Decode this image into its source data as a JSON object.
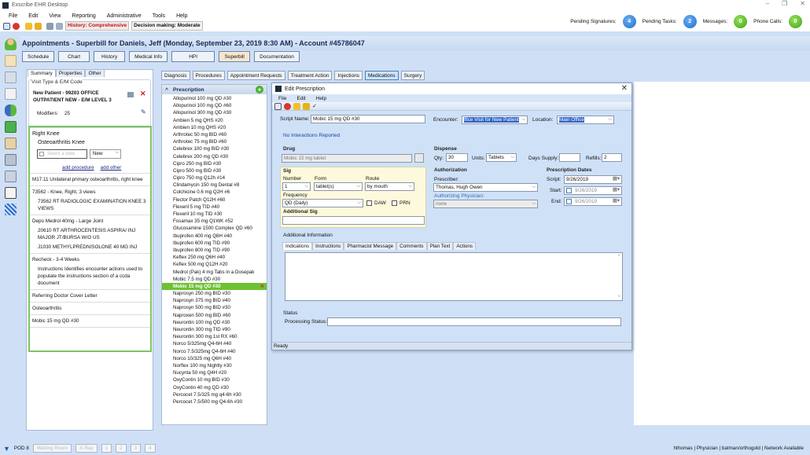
{
  "window": {
    "title": "Exscribe EHR Desktop",
    "controls": [
      "–",
      "❐",
      "✕"
    ]
  },
  "menu": [
    "File",
    "Edit",
    "View",
    "Reporting",
    "Administrative",
    "Tools",
    "Help"
  ],
  "toolbar": {
    "history_badge": "History: Comprehensive",
    "decision_badge": "Decision making: Moderate"
  },
  "notifications": [
    {
      "label": "Pending Signatures:",
      "count": "4",
      "color": "blue"
    },
    {
      "label": "Pending Tasks:",
      "count": "2",
      "color": "blue"
    },
    {
      "label": "Messages:",
      "count": "0",
      "color": "green"
    },
    {
      "label": "Phone Calls:",
      "count": "0",
      "color": "green"
    }
  ],
  "sidebar_icons": [
    "person-icon",
    "calendar-icon",
    "mail-icon",
    "document-icon",
    "users-icon",
    "checklist-icon",
    "notebook-icon",
    "phone-icon",
    "printer-icon",
    "pen-icon",
    "grid-icon"
  ],
  "header": {
    "title": "Appointments - Superbill for Daniels, Jeff (Monday, September 23, 2019 8:30 AM) - Account #45786047"
  },
  "nav_buttons": [
    {
      "label": "Schedule",
      "active": false
    },
    {
      "label": "Chart",
      "active": false
    },
    {
      "label": "History",
      "active": false
    },
    {
      "label": "Medical Info",
      "active": false
    },
    {
      "label": "HPI",
      "active": false
    },
    {
      "label": "Superbill",
      "active": true
    },
    {
      "label": "Documentation",
      "active": false
    }
  ],
  "left_panel": {
    "tabs": [
      "Summary",
      "Properties",
      "Other"
    ],
    "visit_label": "Visit Type & E/M Code",
    "visit_code": "New Patient - 99203 OFFICE OUTPATIENT NEW - E/M LEVEL 3",
    "modifiers_label": "Modifiers:",
    "modifiers_value": "25",
    "section_title": "Right Knee",
    "diagnosis_title": "Osteoarthritis Knee",
    "date_placeholder": "Select a date",
    "status_select": "New",
    "add_procedure": "add procedure",
    "add_other": "add other",
    "items": [
      {
        "text": "M17.11 Unilateral primary osteoarthritis, right knee",
        "sub": []
      },
      {
        "text": "73562 - Knee, Right, 3 views",
        "sub": [
          "73562  RT RADIOLOGIC EXAMINATION KNEE 3 VIEWS"
        ]
      },
      {
        "text": "Depo Medrol 40mg - Large Joint",
        "sub": [
          "20610  RT ARTHROCENTESIS ASPIRA/ INJ MAJOR JT/BURSA W/O US",
          "J1030  METHYLPREDNISOLONE 40 MG INJ"
        ]
      },
      {
        "text": "Recheck - 3-4 Weeks",
        "sub": [
          "Instructions Identifies encounter actions used to populate the instructions section of a ccda document"
        ]
      },
      {
        "text": "Referring Doctor Cover Letter",
        "sub": []
      },
      {
        "text": "Osteoarthritis",
        "sub": []
      },
      {
        "text": "Mobic 15 mg QD #30",
        "sub": []
      }
    ]
  },
  "right_tabs": [
    {
      "label": "Diagnosis",
      "active": false
    },
    {
      "label": "Procedures",
      "active": false
    },
    {
      "label": "Appointment Requests",
      "active": false
    },
    {
      "label": "Treatment Action",
      "active": false
    },
    {
      "label": "Injections",
      "active": false
    },
    {
      "label": "Medications",
      "active": true
    },
    {
      "label": "Surgery",
      "active": false
    }
  ],
  "prescriptions": {
    "title": "Prescription",
    "selected_index": 23,
    "items": [
      "Allopurinol 100 mg QD #30",
      "Allopurinol 100 mg QD #60",
      "Allopurinol 300 mg QD #30",
      "Ambien 5 mg QHS #20",
      "Ambien 10 mg QHS #20",
      "Arthrotec 50 mg BID #60",
      "Arthrotec 75 mg BID #60",
      "Celebrex 100 mg BID #30",
      "Celebrex 200 mg QD #30",
      "Cipro 250 mg BID #30",
      "Cipro 500 mg BID #30",
      "Cipro 750 mg Q12h #14",
      "Clindamycin 150 mg Dental #8",
      "Colchicine 0.6 mg Q2H #6",
      "Flector Patch Q12H #60",
      "Flexeril 5 mg TID #40",
      "Flexeril 10 mg TID #30",
      "Fosamax 35 mg Q1WK #52",
      "Glucosamine 1500 Complex QD #60",
      "Ibuprofen 400 mg Q8H #40",
      "Ibuprofen 600 mg TID #90",
      "Ibuprofen 800 mg TID #90",
      "Keflex 250 mg Q6H #40",
      "Keflex 500 mg Q12H #20",
      "Medrol (Pak) 4 mg Tabs in a Dosepak",
      "Mobic 7.5 mg QD #30",
      "Mobic 15 mg QD #30",
      "Naprosyn 250 mg BID #30",
      "Naprosyn 375 mg BID #40",
      "Naprosyn 500 mg BID #30",
      "Naproxen 500 mg BID #60",
      "Neurontin 100 mg QD #30",
      "Neurontin 300 mg TID #90",
      "Neurontin 300 mg 1st RX #60",
      "Norco 5/325mg  Q4-6H #40",
      "Norco 7.5/325mg Q4-6H #40",
      "Norco 10/325 mg  Q6H #40",
      "Norflex 100 mg Nightly #30",
      "Nucynta 50 mg Q4H #20",
      "OxyContin 10 mg BID #30",
      "OxyContin 40 mg QD #30",
      "Percocet 7.5/325 mg q4-6h #30",
      "Percocet 7.5/500 mg Q4-6h #30"
    ]
  },
  "dialog": {
    "title": "Edit Prescription",
    "menu": [
      "File",
      "Edit",
      "Help"
    ],
    "script_name_label": "Script Name:",
    "script_name": "Mobic 15 mg QD #30",
    "encounter_label": "Encounter:",
    "encounter": "ffice Visit for New Patient",
    "location_label": "Location:",
    "location": "Main Office",
    "interactions": "No Interactions Reported",
    "drug_label": "Drug",
    "drug": "Mobic 15 mg tablet",
    "sig_label": "Sig",
    "number_label": "Number",
    "number": "1",
    "form_label": "Form",
    "form": "tablet(s)",
    "route_label": "Route",
    "route": "by mouth",
    "frequency_label": "Frequency",
    "frequency": "QD (Daily)",
    "daw_label": "DAW",
    "prn_label": "PRN",
    "additional_sig_label": "Additional Sig",
    "additional_sig": "",
    "dispense_label": "Dispense",
    "qty_label": "Qty:",
    "qty": "30",
    "units_label": "Units:",
    "units": "Tablets",
    "days_supply_label": "Days Supply:",
    "days_supply": "",
    "refills_label": "Refills:",
    "refills": "2",
    "authorization_label": "Authorization",
    "prescriber_label": "Prescriber:",
    "prescriber": "Thomas, Hugh Owen",
    "authorizing_label": "Authorizing Physician:",
    "authorizing": "none",
    "dates_label": "Prescription Dates",
    "script_date_label": "Script:",
    "script_date": "9/26/2019",
    "start_label": "Start:",
    "start_date": "9/26/2019",
    "end_label": "End:",
    "end_date": "9/26/2019",
    "additional_info_label": "Additional Information",
    "info_tabs": [
      "Indications",
      "Instructions",
      "Pharmacist Message",
      "Comments",
      "Plan Text",
      "Actions"
    ],
    "status_label": "Status",
    "processing_label": "Processing Status:",
    "processing": "",
    "statusbar": "Ready"
  },
  "bottom": {
    "pod": "POD 8",
    "rooms": [
      "Waiting Room",
      "X-Ray",
      "1",
      "2",
      "3",
      "4"
    ],
    "user_info": "hthomas | Physician | batman/orthogold | Network Available"
  }
}
